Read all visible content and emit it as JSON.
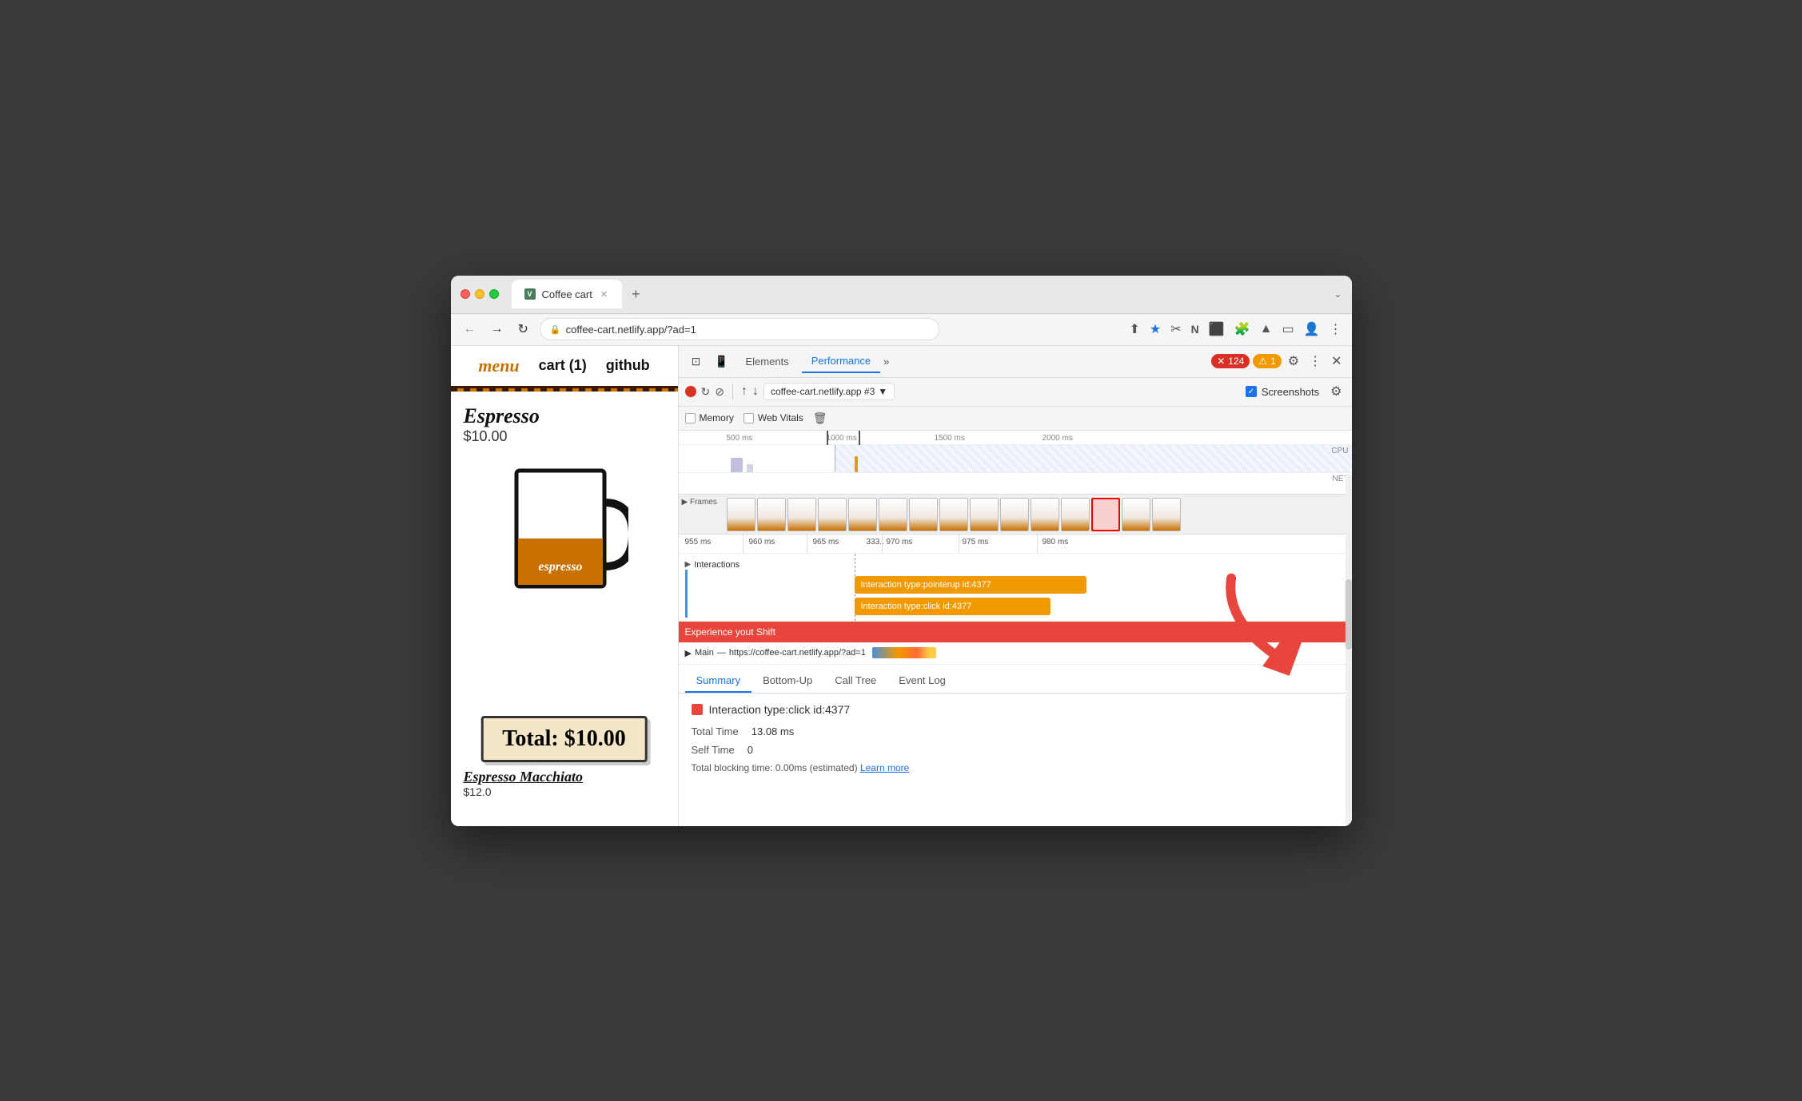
{
  "browser": {
    "tab_title": "Coffee cart",
    "tab_favicon": "V",
    "tab_close": "✕",
    "new_tab": "+",
    "chevron": "⌄",
    "back_btn": "←",
    "forward_btn": "→",
    "refresh_btn": "↻",
    "url": "coffee-cart.netlify.app/?ad=1",
    "toolbar_icons": [
      "share",
      "star",
      "scissors",
      "notion",
      "extensions",
      "puzzle",
      "person",
      "more"
    ]
  },
  "site": {
    "nav_menu": "menu",
    "nav_cart": "cart (1)",
    "nav_github": "github",
    "espresso_name": "Espresso",
    "espresso_price": "$10.00",
    "espresso_label": "espresso",
    "cart_total": "Total: $10.00",
    "macchiato_name": "Espresso Macchiato",
    "macchiato_price": "$12.0"
  },
  "devtools": {
    "header": {
      "elements_tab": "Elements",
      "performance_tab": "Performance",
      "more": "»",
      "error_count": "124",
      "warn_count": "1",
      "gear_icon": "⚙",
      "more_icon": "⋮",
      "close_icon": "✕"
    },
    "toolbar": {
      "target": "coffee-cart.netlify.app #3",
      "screenshots_label": "Screenshots",
      "settings_icon": "⚙"
    },
    "options": {
      "memory_label": "Memory",
      "web_vitals_label": "Web Vitals"
    },
    "timeline": {
      "marks": [
        "500 ms",
        "1000 ms",
        "1500 ms",
        "2000 ms"
      ],
      "cpu_label": "CPU",
      "net_label": "NET"
    },
    "frames": {
      "label": "Frames"
    },
    "timing": {
      "marks": [
        "955 ms",
        "960 ms",
        "965 ms",
        "333..",
        "970 ms",
        "975 ms",
        "980 ms"
      ]
    },
    "interactions": {
      "label": "Interactions",
      "bar1_text": "Interaction type:pointerup id:4377",
      "bar2_text": "Interaction type:click id:4377"
    },
    "layout_shift": {
      "text": "Experience yout Shift"
    },
    "main_thread": {
      "label": "Main",
      "separator": "—",
      "url": "https://coffee-cart.netlify.app/?ad=1"
    },
    "summary_tabs": {
      "summary": "Summary",
      "bottom_up": "Bottom-Up",
      "call_tree": "Call Tree",
      "event_log": "Event Log"
    },
    "summary_content": {
      "color": "#e8453c",
      "title": "Interaction type:click id:4377",
      "total_time_label": "Total Time",
      "total_time_value": "13.08 ms",
      "self_time_label": "Self Time",
      "self_time_value": "0",
      "blocking_text": "Total blocking time: 0.00ms (estimated)",
      "learn_more": "Learn more"
    }
  }
}
